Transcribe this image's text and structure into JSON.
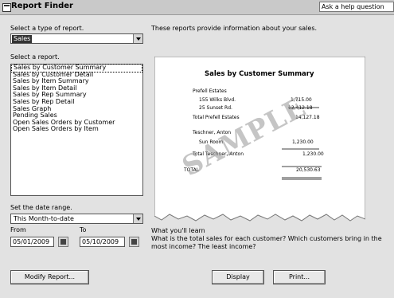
{
  "window": {
    "title": "Report Finder",
    "help_box": "Ask a help question"
  },
  "left": {
    "type_label": "Select a type of report.",
    "type_value": "Sales",
    "report_label": "Select a report.",
    "reports": [
      "Sales by Customer Summary",
      "Sales by Customer Detail",
      "Sales by Item Summary",
      "Sales by Item Detail",
      "Sales by Rep Summary",
      "Sales by Rep Detail",
      "Sales Graph",
      "Pending Sales",
      "Open Sales Orders by Customer",
      "Open Sales Orders by Item"
    ],
    "date_range_label": "Set the date range.",
    "date_range_value": "This Month-to-date",
    "from_label": "From",
    "to_label": "To",
    "from_date": "05/01/2009",
    "to_date": "05/10/2009",
    "modify_button": "Modify Report..."
  },
  "right": {
    "description": "These reports provide information about your sales.",
    "learn_heading": "What you'll learn",
    "learn_text": "What is the total sales for each customer? Which customers bring in the most income? The least income?",
    "display_button": "Display",
    "print_button": "Print..."
  },
  "preview": {
    "title": "Sales by Customer Summary",
    "watermark": "SAMPLE",
    "rows": [
      {
        "label": "Prefell Estates",
        "value": ""
      },
      {
        "label": "155 Wilks Blvd.",
        "value": "1,715.00"
      },
      {
        "label": "25 Sunset Rd.",
        "value": "12,412.18"
      },
      {
        "label": "Total Prefell Estates",
        "value": "14,127.18"
      },
      {
        "label": "Teschner, Anton",
        "value": ""
      },
      {
        "label": "Sun Room",
        "value": "1,230.00"
      },
      {
        "label": "Total Teschner, Anton",
        "value": "1,230.00"
      },
      {
        "label": "TOTAL",
        "value": "20,530.63"
      }
    ]
  }
}
